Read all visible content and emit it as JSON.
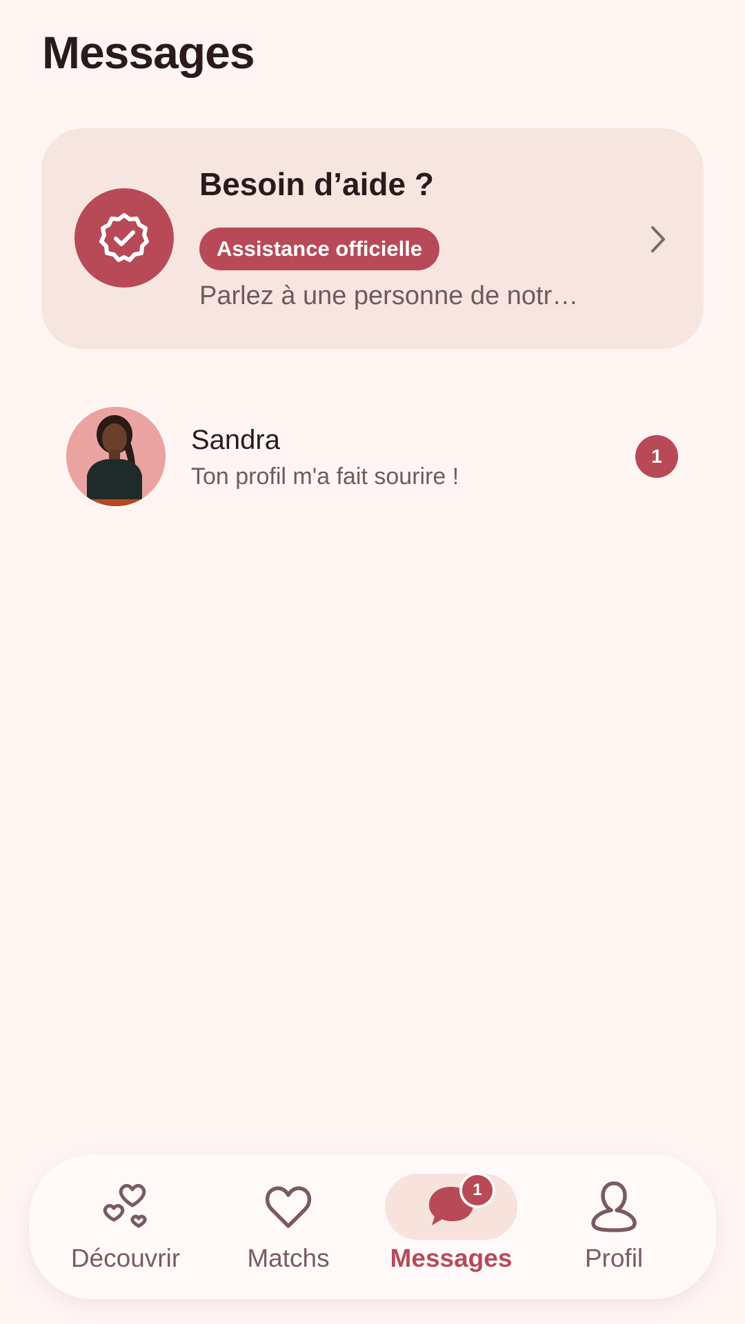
{
  "page": {
    "title": "Messages"
  },
  "help_card": {
    "title": "Besoin d’aide ?",
    "badge_label": "Assistance officielle",
    "subtitle": "Parlez à une personne de notr…",
    "icon": "verified-badge-icon",
    "chevron": "chevron-right-icon"
  },
  "conversations": [
    {
      "name": "Sandra",
      "preview": "Ton profil m'a fait sourire !",
      "unread": "1"
    }
  ],
  "nav": {
    "items": [
      {
        "label": "Découvrir",
        "icon": "hearts-icon",
        "active": false
      },
      {
        "label": "Matchs",
        "icon": "heart-icon",
        "active": false
      },
      {
        "label": "Messages",
        "icon": "chat-bubble-icon",
        "active": true,
        "badge": "1"
      },
      {
        "label": "Profil",
        "icon": "person-icon",
        "active": false
      }
    ]
  },
  "colors": {
    "background": "#fff6f4",
    "accent": "#b84a58",
    "card": "#f7e5e0",
    "text": "#2a1a1d",
    "muted": "#6e5a5e"
  }
}
